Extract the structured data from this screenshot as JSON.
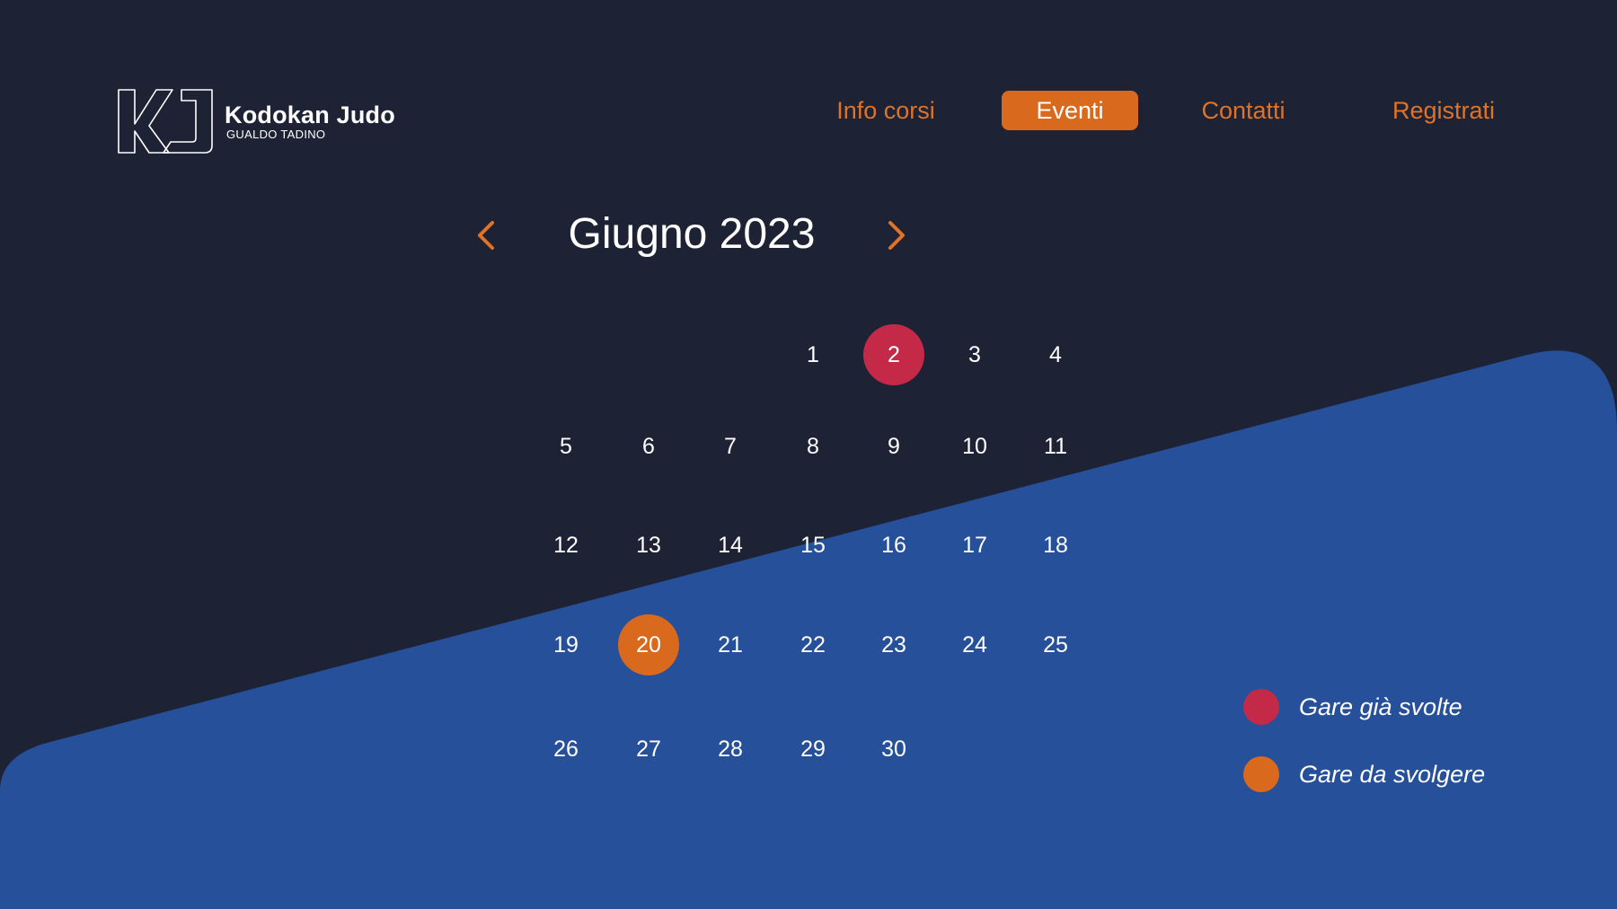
{
  "brand": {
    "title": "Kodokan Judo",
    "subtitle": "GUALDO TADINO"
  },
  "nav": [
    {
      "label": "Info corsi",
      "active": false
    },
    {
      "label": "Eventi",
      "active": true
    },
    {
      "label": "Contatti",
      "active": false
    },
    {
      "label": "Registrati",
      "active": false
    }
  ],
  "calendar": {
    "month_label": "Giugno 2023",
    "days": [
      {
        "label": "1",
        "status": "normal"
      },
      {
        "label": "2",
        "status": "done"
      },
      {
        "label": "3",
        "status": "normal"
      },
      {
        "label": "4",
        "status": "normal"
      },
      {
        "label": "5",
        "status": "normal"
      },
      {
        "label": "6",
        "status": "normal"
      },
      {
        "label": "7",
        "status": "normal"
      },
      {
        "label": "8",
        "status": "normal"
      },
      {
        "label": "9",
        "status": "normal"
      },
      {
        "label": "10",
        "status": "normal"
      },
      {
        "label": "11",
        "status": "normal"
      },
      {
        "label": "12",
        "status": "normal"
      },
      {
        "label": "13",
        "status": "normal"
      },
      {
        "label": "14",
        "status": "normal"
      },
      {
        "label": "15",
        "status": "normal"
      },
      {
        "label": "16",
        "status": "normal"
      },
      {
        "label": "17",
        "status": "normal"
      },
      {
        "label": "18",
        "status": "normal"
      },
      {
        "label": "19",
        "status": "normal"
      },
      {
        "label": "20",
        "status": "upcoming"
      },
      {
        "label": "21",
        "status": "normal"
      },
      {
        "label": "22",
        "status": "normal"
      },
      {
        "label": "23",
        "status": "normal"
      },
      {
        "label": "24",
        "status": "normal"
      },
      {
        "label": "25",
        "status": "normal"
      },
      {
        "label": "26",
        "status": "normal"
      },
      {
        "label": "27",
        "status": "normal"
      },
      {
        "label": "28",
        "status": "normal"
      },
      {
        "label": "29",
        "status": "normal"
      },
      {
        "label": "30",
        "status": "normal"
      }
    ]
  },
  "legend": {
    "done_label": "Gare già svolte",
    "upcoming_label": "Gare da svolgere"
  },
  "icons": {
    "prev": "chevron-left-icon",
    "next": "chevron-right-icon"
  },
  "colors": {
    "background": "#1e2235",
    "blue_shape": "#27509a",
    "accent": "#d9691d",
    "done": "#c42a47"
  }
}
